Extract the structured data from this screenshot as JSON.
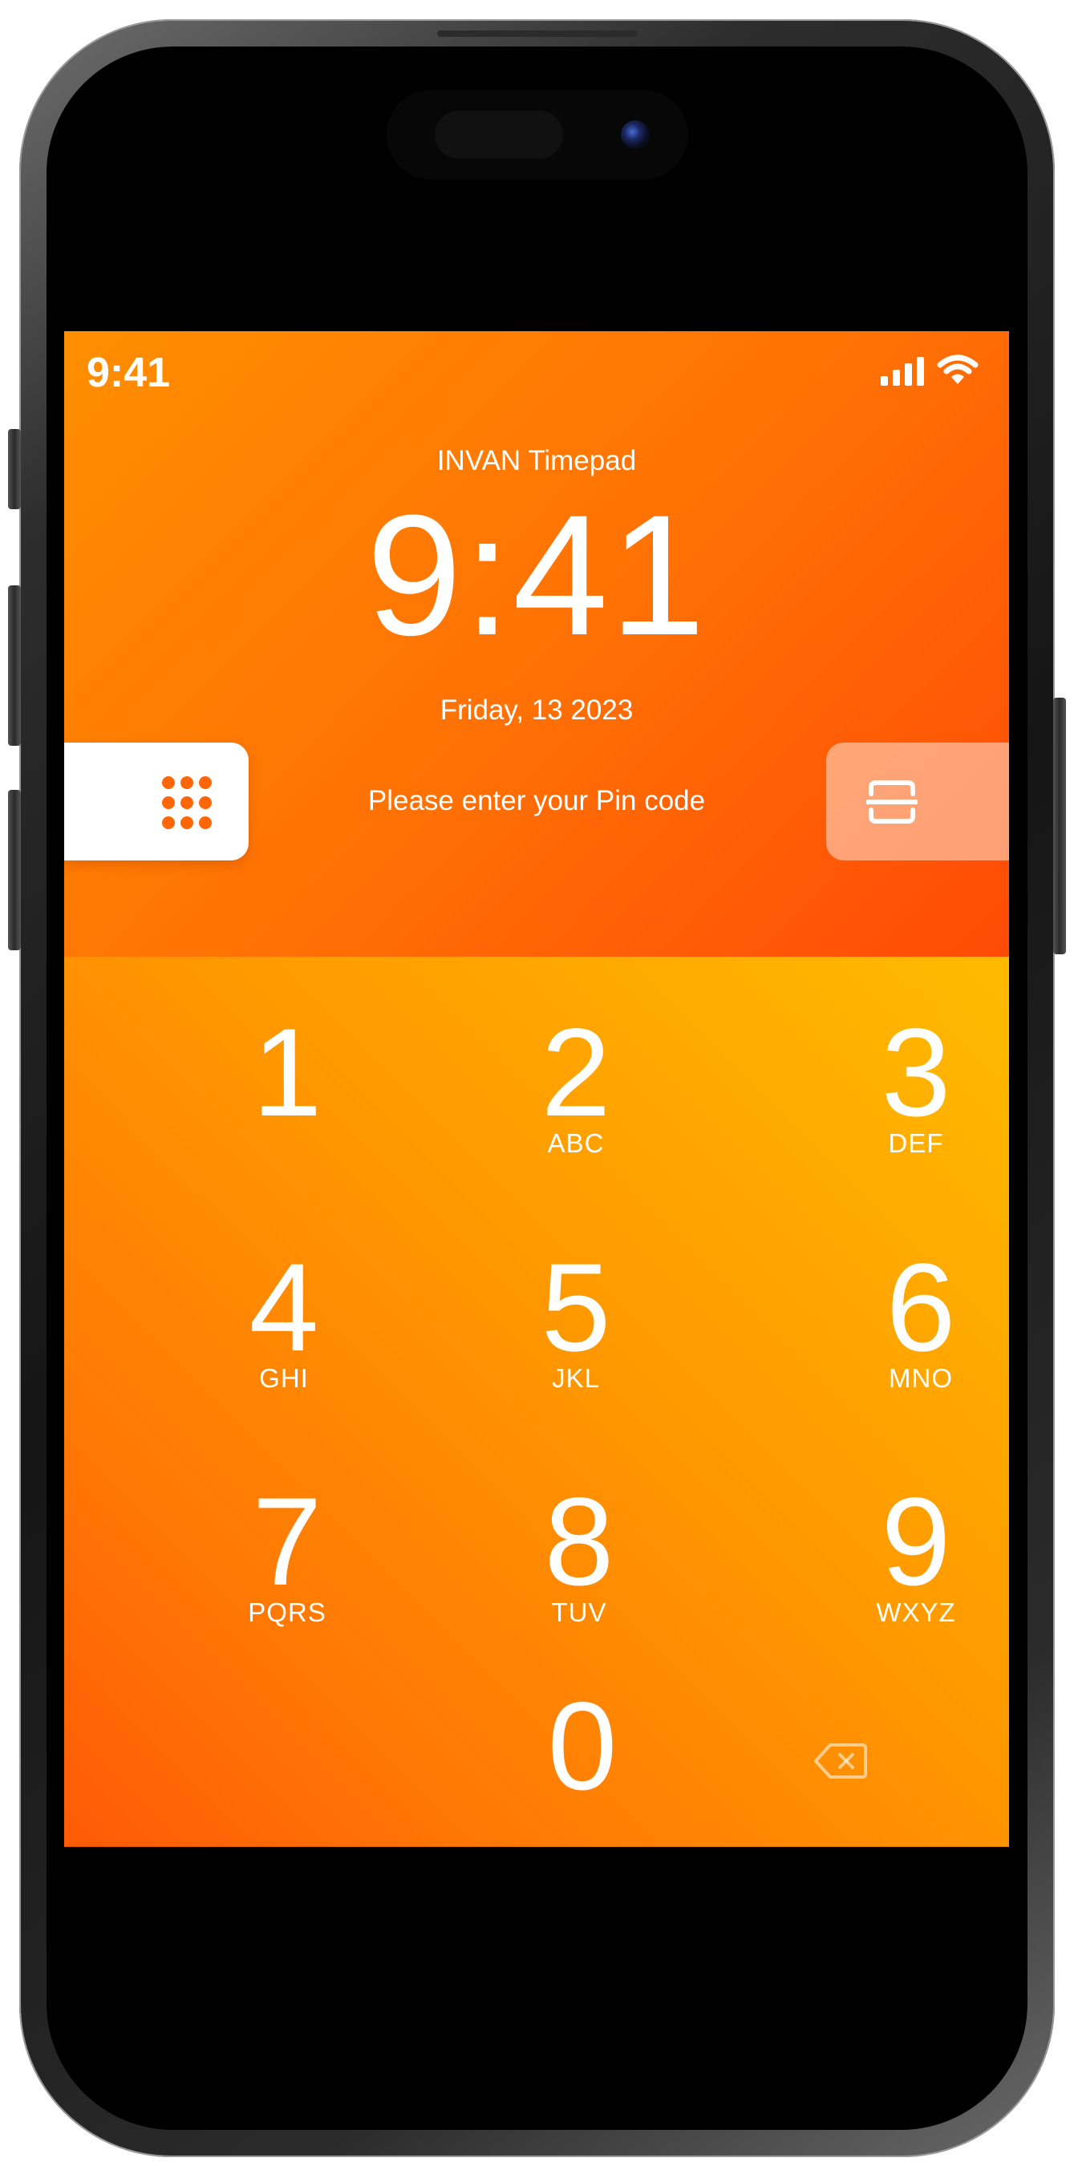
{
  "status_bar": {
    "time": "9:41"
  },
  "app": {
    "name": "INVAN Timepad"
  },
  "clock": {
    "time": "9:41",
    "date": "Friday, 13 2023"
  },
  "prompt": {
    "text": "Please enter your Pin code"
  },
  "mode_buttons": {
    "keypad_icon": "keypad-grid-icon",
    "scan_icon": "scan-qr-icon"
  },
  "keypad": {
    "keys": [
      {
        "digit": "1",
        "letters": ""
      },
      {
        "digit": "2",
        "letters": "ABC"
      },
      {
        "digit": "3",
        "letters": "DEF"
      },
      {
        "digit": "4",
        "letters": "GHI"
      },
      {
        "digit": "5",
        "letters": "JKL"
      },
      {
        "digit": "6",
        "letters": "MNO"
      },
      {
        "digit": "7",
        "letters": "PQRS"
      },
      {
        "digit": "8",
        "letters": "TUV"
      },
      {
        "digit": "9",
        "letters": "WXYZ"
      },
      {
        "digit": "0",
        "letters": ""
      }
    ],
    "backspace_icon": "backspace-icon"
  },
  "colors": {
    "header_start": "#ff8f00",
    "header_end": "#ff4a06",
    "keypad_start": "#ffbb00",
    "keypad_end": "#ff5a07",
    "accent": "#ff6608"
  }
}
